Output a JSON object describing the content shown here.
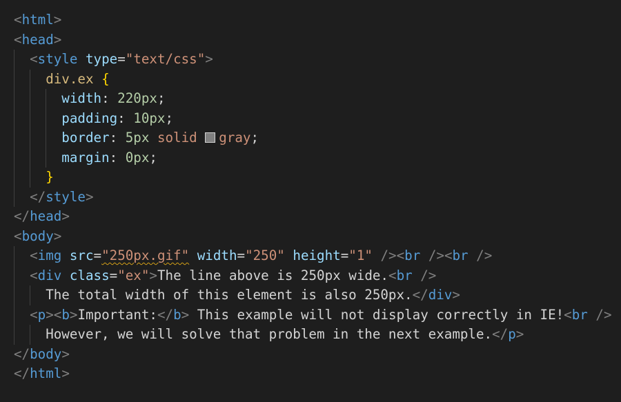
{
  "colors": {
    "background": "#1e1e1e",
    "punct": "#808080",
    "tag": "#569cd6",
    "attr": "#9cdcfe",
    "string": "#ce9178",
    "text": "#d4d4d4",
    "selector": "#d7ba7d",
    "number": "#b5cea8",
    "brace": "#ffd700",
    "indent_guide": "#404040",
    "swatch_fill": "#808080",
    "squiggle": "#d4a017"
  },
  "code_lines": [
    {
      "col": 0,
      "tokens": [
        {
          "t": "<",
          "c": "punct"
        },
        {
          "t": "html",
          "c": "tag"
        },
        {
          "t": ">",
          "c": "punct"
        }
      ]
    },
    {
      "col": 0,
      "tokens": [
        {
          "t": "<",
          "c": "punct"
        },
        {
          "t": "head",
          "c": "tag"
        },
        {
          "t": ">",
          "c": "punct"
        }
      ]
    },
    {
      "col": 2,
      "tokens": [
        {
          "t": "<",
          "c": "punct"
        },
        {
          "t": "style",
          "c": "tag"
        },
        {
          "t": " "
        },
        {
          "t": "type",
          "c": "attr"
        },
        {
          "t": "=",
          "c": "text"
        },
        {
          "t": "\"text/css\"",
          "c": "string"
        },
        {
          "t": ">",
          "c": "punct"
        }
      ]
    },
    {
      "col": 4,
      "tokens": [
        {
          "t": "div.ex",
          "c": "selector"
        },
        {
          "t": " "
        },
        {
          "t": "{",
          "c": "brace"
        }
      ]
    },
    {
      "col": 6,
      "tokens": [
        {
          "t": "width",
          "c": "attr"
        },
        {
          "t": ": ",
          "c": "text"
        },
        {
          "t": "220px",
          "c": "number"
        },
        {
          "t": ";",
          "c": "text"
        }
      ]
    },
    {
      "col": 6,
      "tokens": [
        {
          "t": "padding",
          "c": "attr"
        },
        {
          "t": ": ",
          "c": "text"
        },
        {
          "t": "10px",
          "c": "number"
        },
        {
          "t": ";",
          "c": "text"
        }
      ]
    },
    {
      "col": 6,
      "tokens": [
        {
          "t": "border",
          "c": "attr"
        },
        {
          "t": ": ",
          "c": "text"
        },
        {
          "t": "5px",
          "c": "number"
        },
        {
          "t": " "
        },
        {
          "t": "solid",
          "c": "string"
        },
        {
          "t": " "
        },
        {
          "swatch": true
        },
        {
          "t": "gray",
          "c": "string"
        },
        {
          "t": ";",
          "c": "text"
        }
      ]
    },
    {
      "col": 6,
      "tokens": [
        {
          "t": "margin",
          "c": "attr"
        },
        {
          "t": ": ",
          "c": "text"
        },
        {
          "t": "0px",
          "c": "number"
        },
        {
          "t": ";",
          "c": "text"
        }
      ]
    },
    {
      "col": 4,
      "tokens": [
        {
          "t": "}",
          "c": "brace"
        }
      ]
    },
    {
      "col": 2,
      "tokens": [
        {
          "t": "</",
          "c": "punct"
        },
        {
          "t": "style",
          "c": "tag"
        },
        {
          "t": ">",
          "c": "punct"
        }
      ]
    },
    {
      "col": 0,
      "tokens": [
        {
          "t": "</",
          "c": "punct"
        },
        {
          "t": "head",
          "c": "tag"
        },
        {
          "t": ">",
          "c": "punct"
        }
      ]
    },
    {
      "col": 0,
      "tokens": [
        {
          "t": "<",
          "c": "punct"
        },
        {
          "t": "body",
          "c": "tag"
        },
        {
          "t": ">",
          "c": "punct"
        }
      ]
    },
    {
      "col": 2,
      "tokens": [
        {
          "t": "<",
          "c": "punct"
        },
        {
          "t": "img",
          "c": "tag"
        },
        {
          "t": " "
        },
        {
          "t": "src",
          "c": "attr"
        },
        {
          "t": "=",
          "c": "text"
        },
        {
          "t": "\"250px.gif\"",
          "c": "string",
          "squiggle": true
        },
        {
          "t": " "
        },
        {
          "t": "width",
          "c": "attr"
        },
        {
          "t": "=",
          "c": "text"
        },
        {
          "t": "\"250\"",
          "c": "string"
        },
        {
          "t": " "
        },
        {
          "t": "height",
          "c": "attr"
        },
        {
          "t": "=",
          "c": "text"
        },
        {
          "t": "\"1\"",
          "c": "string"
        },
        {
          "t": " "
        },
        {
          "t": "/>",
          "c": "punct"
        },
        {
          "t": "<",
          "c": "punct"
        },
        {
          "t": "br",
          "c": "tag"
        },
        {
          "t": " "
        },
        {
          "t": "/>",
          "c": "punct"
        },
        {
          "t": "<",
          "c": "punct"
        },
        {
          "t": "br",
          "c": "tag"
        },
        {
          "t": " "
        },
        {
          "t": "/>",
          "c": "punct"
        }
      ]
    },
    {
      "col": 2,
      "tokens": [
        {
          "t": "<",
          "c": "punct"
        },
        {
          "t": "div",
          "c": "tag"
        },
        {
          "t": " "
        },
        {
          "t": "class",
          "c": "attr"
        },
        {
          "t": "=",
          "c": "text"
        },
        {
          "t": "\"ex\"",
          "c": "string"
        },
        {
          "t": ">",
          "c": "punct"
        },
        {
          "t": "The line above is 250px wide.",
          "c": "text"
        },
        {
          "t": "<",
          "c": "punct"
        },
        {
          "t": "br",
          "c": "tag"
        },
        {
          "t": " "
        },
        {
          "t": "/>",
          "c": "punct"
        }
      ]
    },
    {
      "col": 4,
      "tokens": [
        {
          "t": "The total width of this element is also 250px.",
          "c": "text"
        },
        {
          "t": "</",
          "c": "punct"
        },
        {
          "t": "div",
          "c": "tag"
        },
        {
          "t": ">",
          "c": "punct"
        }
      ]
    },
    {
      "col": 2,
      "tokens": [
        {
          "t": "<",
          "c": "punct"
        },
        {
          "t": "p",
          "c": "tag"
        },
        {
          "t": ">",
          "c": "punct"
        },
        {
          "t": "<",
          "c": "punct"
        },
        {
          "t": "b",
          "c": "tag"
        },
        {
          "t": ">",
          "c": "punct"
        },
        {
          "t": "Important:",
          "c": "text"
        },
        {
          "t": "</",
          "c": "punct"
        },
        {
          "t": "b",
          "c": "tag"
        },
        {
          "t": ">",
          "c": "punct"
        },
        {
          "t": " This example will not display correctly in IE!",
          "c": "text"
        },
        {
          "t": "<",
          "c": "punct"
        },
        {
          "t": "br",
          "c": "tag"
        },
        {
          "t": " "
        },
        {
          "t": "/>",
          "c": "punct"
        }
      ]
    },
    {
      "col": 4,
      "tokens": [
        {
          "t": "However, we will solve that problem in the next example.",
          "c": "text"
        },
        {
          "t": "</",
          "c": "punct"
        },
        {
          "t": "p",
          "c": "tag"
        },
        {
          "t": ">",
          "c": "punct"
        }
      ]
    },
    {
      "col": 0,
      "tokens": [
        {
          "t": "</",
          "c": "punct"
        },
        {
          "t": "body",
          "c": "tag"
        },
        {
          "t": ">",
          "c": "punct"
        }
      ]
    },
    {
      "col": 0,
      "tokens": [
        {
          "t": "</",
          "c": "punct"
        },
        {
          "t": "html",
          "c": "tag"
        },
        {
          "t": ">",
          "c": "punct"
        }
      ]
    }
  ]
}
